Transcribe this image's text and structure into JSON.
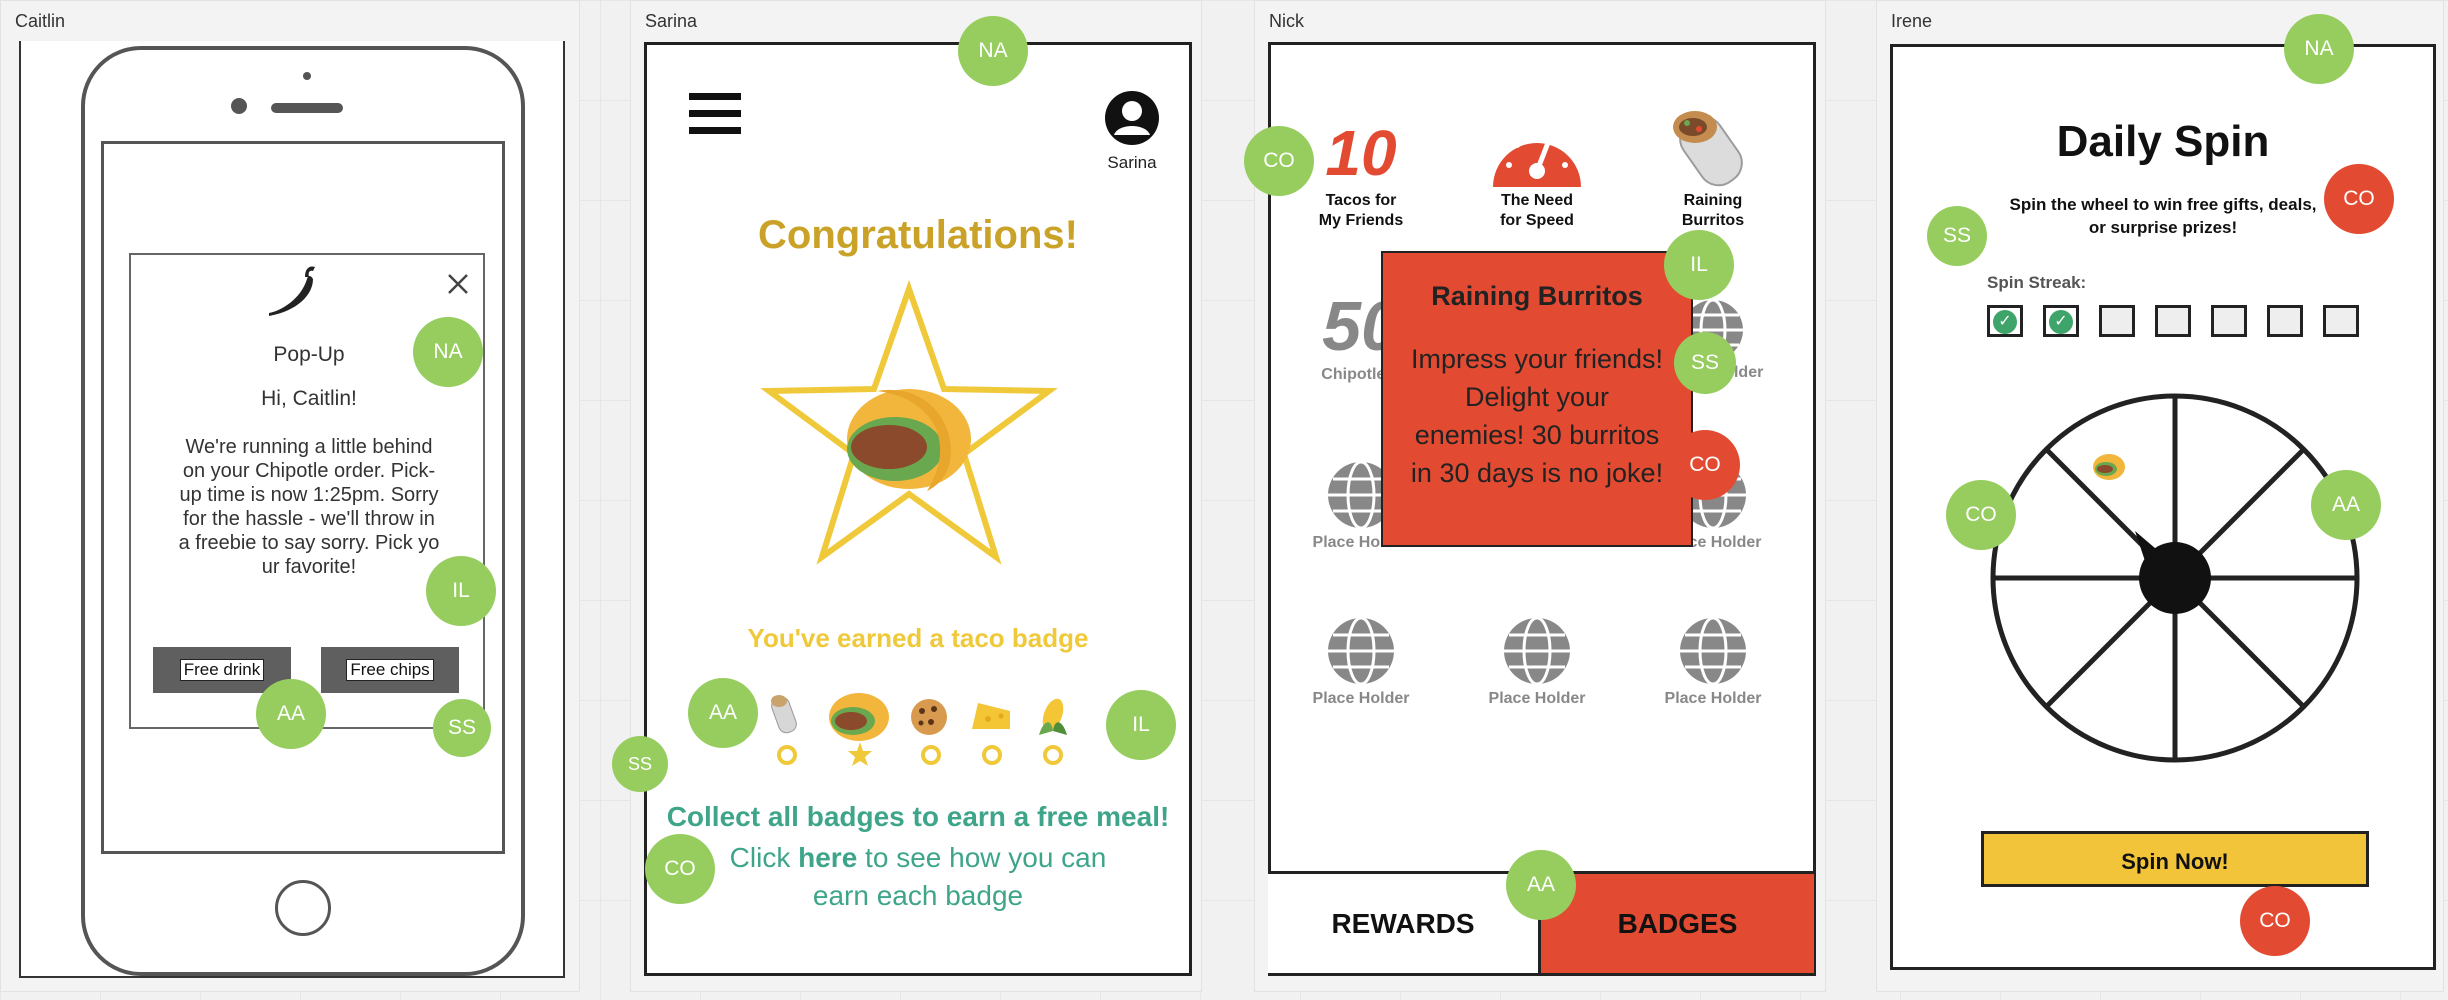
{
  "frames": {
    "caitlin": {
      "label": "Caitlin",
      "popup": {
        "title": "Pop-Up",
        "greeting": "Hi, Caitlin!",
        "message_lines": [
          "We're running a little behind",
          "on your Chipotle order. Pick-",
          "up time is now 1:25pm. Sorry",
          "for the hassle - we'll throw in",
          "a freebie to say sorry. Pick yo",
          "ur favorite!"
        ],
        "button_drink": "Free drink",
        "button_chips": "Free chips"
      },
      "dots": [
        "NA",
        "IL",
        "AA",
        "SS"
      ]
    },
    "sarina": {
      "label": "Sarina",
      "user_name": "Sarina",
      "heading": "Congratulations!",
      "earned_text": "You've earned a taco badge",
      "collect_text": "Collect all badges to earn a free meal!",
      "click_prefix": "Click ",
      "click_link": "here",
      "click_suffix": " to see how you can",
      "click_line2": "earn each badge",
      "dots": [
        "NA",
        "AA",
        "IL",
        "SS",
        "CO"
      ]
    },
    "nick": {
      "label": "Nick",
      "badges": [
        {
          "title_l1": "Tacos for",
          "title_l2": "My Friends",
          "big": "10"
        },
        {
          "title_l1": "The Need",
          "title_l2": "for Speed"
        },
        {
          "title_l1": "Raining",
          "title_l2": "Burritos"
        },
        {
          "title_l1": "Chipotle A",
          "big": "50"
        },
        {
          "title_l1": "Holder"
        },
        {
          "title_l1": "Place Holder"
        },
        {
          "title_l1": "Place Holder"
        },
        {
          "title_l1": "Place Holder"
        },
        {
          "title_l1": "Place Holder"
        },
        {
          "title_l1": "Place Holder"
        },
        {
          "title_l1": "Place Holder"
        }
      ],
      "popover": {
        "title": "Raining Burritos",
        "lines": [
          "Impress your friends!",
          "Delight your",
          "enemies! 30 burritos",
          "in 30 days is no joke!"
        ]
      },
      "tab_rewards": "REWARDS",
      "tab_badges": "BADGES",
      "dots": [
        "CO",
        "IL",
        "SS",
        "CO",
        "AA"
      ]
    },
    "irene": {
      "label": "Irene",
      "title": "Daily Spin",
      "subtitle_l1": "Spin the wheel to win free gifts, deals,",
      "subtitle_l2": "or surprise prizes!",
      "streak_label": "Spin Streak:",
      "streak": [
        true,
        true,
        false,
        false,
        false,
        false,
        false
      ],
      "spin_button": "Spin Now!",
      "dots": [
        "NA",
        "CO",
        "SS",
        "CO",
        "AA",
        "CO"
      ]
    }
  },
  "colors": {
    "dot_green": "#96cd5e",
    "dot_red": "#e24b32",
    "gold": "#c9a227",
    "teal": "#3ea58a",
    "badge_red": "#e24b32",
    "spin_yellow": "#f2c43a"
  }
}
